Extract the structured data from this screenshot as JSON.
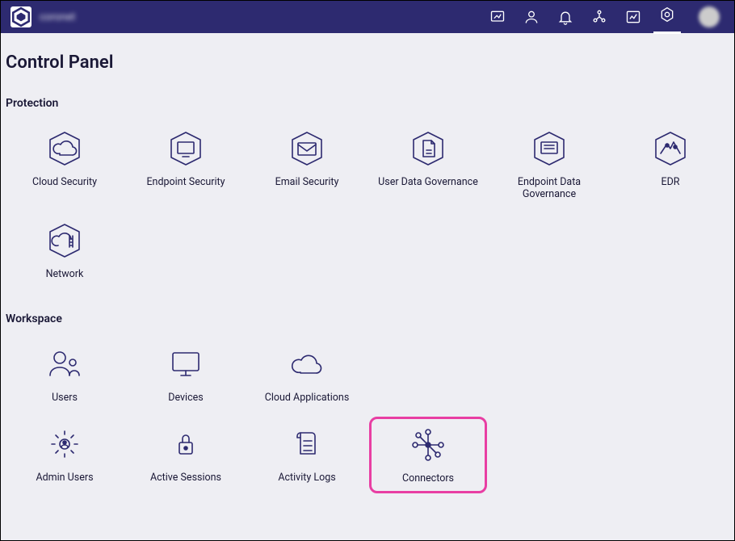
{
  "brand": "coronet",
  "page_title": "Control Panel",
  "sections": {
    "protection": {
      "title": "Protection",
      "items": [
        "Cloud Security",
        "Endpoint Security",
        "Email Security",
        "User Data Governance",
        "Endpoint Data Governance",
        "EDR",
        "Network"
      ]
    },
    "workspace": {
      "title": "Workspace",
      "items": [
        "Users",
        "Devices",
        "Cloud Applications",
        "Admin Users",
        "Active Sessions",
        "Activity Logs",
        "Connectors"
      ]
    }
  }
}
